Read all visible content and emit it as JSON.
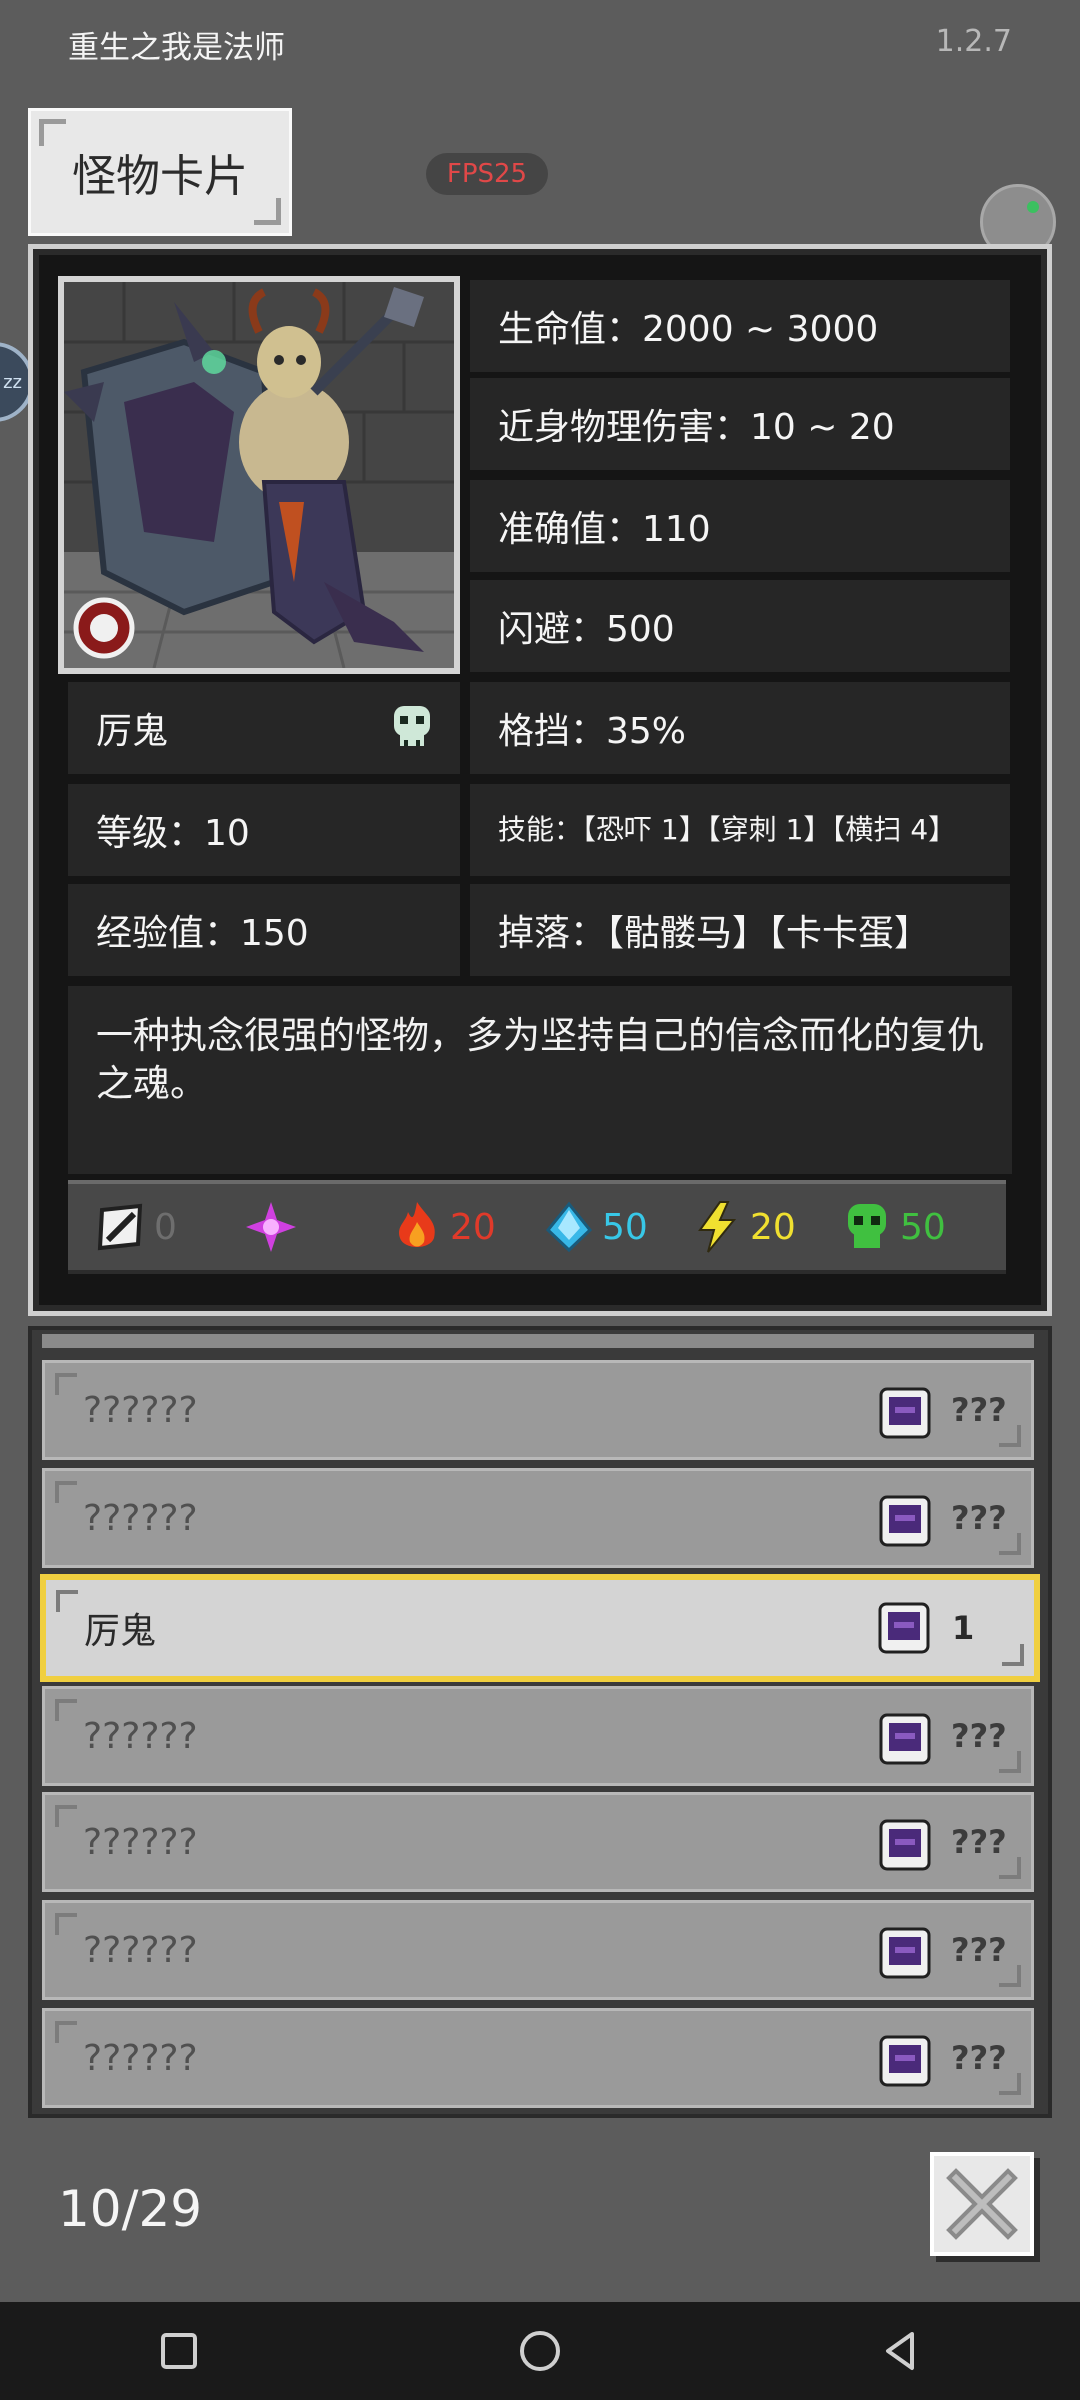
{
  "app": {
    "title": "重生之我是法师",
    "version": "1.2.7"
  },
  "tab": {
    "label": "怪物卡片"
  },
  "fps": "FPS25",
  "monster": {
    "name": "厉鬼",
    "hp": "生命值：2000 ~ 3000",
    "melee": "近身物理伤害：10 ~ 20",
    "accuracy": "准确值：110",
    "dodge": "闪避：500",
    "block": "格挡：35%",
    "level": "等级：10",
    "skills": "技能：【恐吓 1】【穿刺 1】【横扫 4】",
    "exp": "经验值：150",
    "drops": "掉落：【骷髅马】【卡卡蛋】",
    "description": "一种执念很强的怪物，多为坚持自己的信念而化的复仇之魂。"
  },
  "resistances": [
    {
      "icon": "physical-shield-icon",
      "value": "0",
      "color": "#6e6e6e"
    },
    {
      "icon": "arcane-star-icon",
      "value": "",
      "color": "#7a3a8a"
    },
    {
      "icon": "fire-icon",
      "value": "20",
      "color": "#e03a2a"
    },
    {
      "icon": "ice-crystal-icon",
      "value": "50",
      "color": "#38c8e8"
    },
    {
      "icon": "lightning-icon",
      "value": "20",
      "color": "#f0e030"
    },
    {
      "icon": "poison-skull-icon",
      "value": "50",
      "color": "#40c040"
    }
  ],
  "list": [
    {
      "name": "??????",
      "count": "???",
      "selected": false
    },
    {
      "name": "??????",
      "count": "???",
      "selected": false
    },
    {
      "name": "厉鬼",
      "count": "1",
      "selected": true
    },
    {
      "name": "??????",
      "count": "???",
      "selected": false
    },
    {
      "name": "??????",
      "count": "???",
      "selected": false
    },
    {
      "name": "??????",
      "count": "???",
      "selected": false
    },
    {
      "name": "??????",
      "count": "???",
      "selected": false
    }
  ],
  "pager": {
    "text": "10/29"
  },
  "side_ball": {
    "label": "zz"
  }
}
